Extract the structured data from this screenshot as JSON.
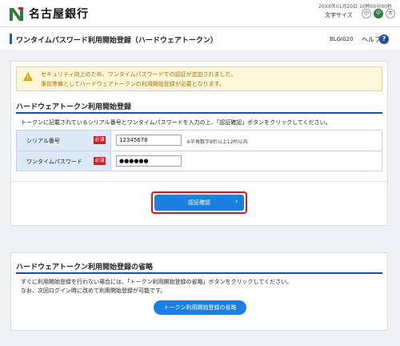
{
  "header": {
    "bank_name": "名古屋銀行",
    "datetime": "20XX年01月20日 10時00分00秒",
    "font_size_label": "文字サイズ",
    "font_sizes": [
      "小",
      "中",
      "大"
    ],
    "active_font_size": "中",
    "brand_color": "#2d7b3e"
  },
  "page": {
    "title": "ワンタイムパスワード利用開始登録（ハードウェアトークン）",
    "screen_id": "BLGI020",
    "help_label": "ヘルプ",
    "help_icon_glyph": "?"
  },
  "notice": {
    "icon": "warning-icon",
    "icon_glyph": "!",
    "lines": [
      "セキュリティ向上のため、ワンタイムパスワードでの認証が追加されました。",
      "事前準備としてハードウェアトークンの利用開始登録が必要となります。"
    ]
  },
  "registration": {
    "section_title": "ハードウェアトークン利用開始登録",
    "instruction": "トークンに記載されているシリアル番号とワンタイムパスワードを入力の上、「認証確認」ボタンをクリックしてください。",
    "required_label": "必須",
    "fields": [
      {
        "label": "シリアル番号",
        "value": "12345678",
        "hint": "※半角数字8桁以上12桁以内"
      },
      {
        "label": "ワンタイムパスワード",
        "value": "●●●●●●"
      }
    ],
    "submit_label": "認証確認",
    "submit_chevron": "›",
    "accent_color": "#1a7fe0",
    "highlight_color": "#e8111c"
  },
  "skip": {
    "section_title": "ハードウェアトークン利用開始登録の省略",
    "lines": [
      "すぐに利用開始登録を行わない場合には、「トークン利用開始登録の省略」ボタンをクリックしてください。",
      "なお、次回ログイン時に改めて利用開始登録が可能です。"
    ],
    "button_label": "トークン利用開始登録の省略"
  }
}
